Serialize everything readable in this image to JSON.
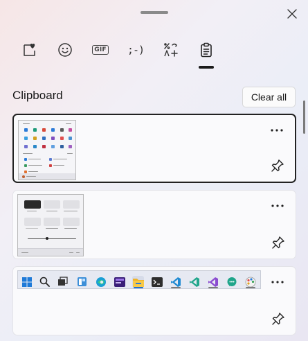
{
  "header": {
    "tabs": [
      {
        "name": "stickers",
        "icon": "heart-badge-icon"
      },
      {
        "name": "emoji",
        "icon": "emoji-smiley-icon"
      },
      {
        "name": "gif",
        "icon": "gif-icon",
        "glyph": "GIF"
      },
      {
        "name": "kaomoji",
        "icon": "kaomoji-icon",
        "glyph": ";-)"
      },
      {
        "name": "symbols",
        "icon": "symbols-icon"
      },
      {
        "name": "clipboard",
        "icon": "clipboard-icon",
        "active": true
      }
    ]
  },
  "clipboard": {
    "title": "Clipboard",
    "clear_all_label": "Clear all",
    "items": [
      {
        "type": "screenshot",
        "content": "start-menu-screenshot",
        "selected": true
      },
      {
        "type": "screenshot",
        "content": "quick-settings-screenshot",
        "selected": false
      },
      {
        "type": "screenshot",
        "content": "taskbar-screenshot",
        "selected": false
      }
    ]
  },
  "colors": {
    "selected_border": "#222222",
    "item_background": "#fafafc",
    "accent_blue": "#0b6cd6"
  }
}
